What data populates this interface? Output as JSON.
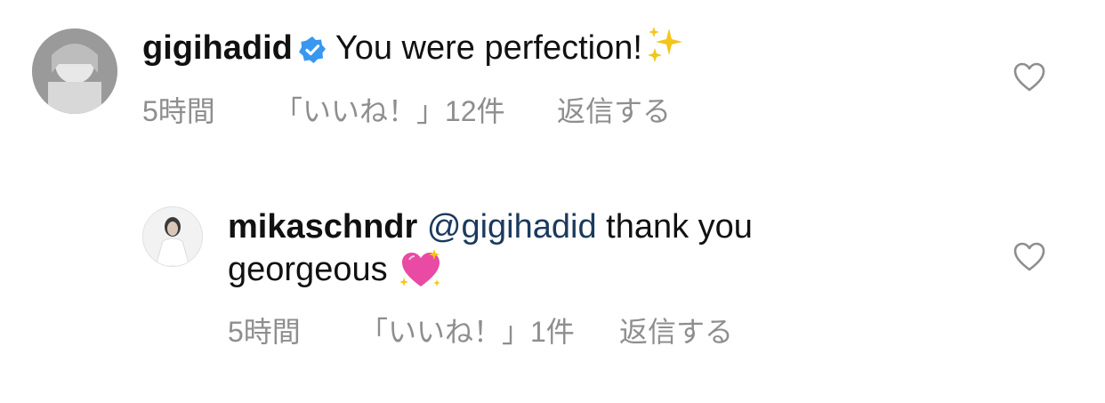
{
  "comments": [
    {
      "username": "gigihadid",
      "verified": true,
      "text": "You were perfection!",
      "emoji": "sparkles",
      "time": "5時間",
      "likes": "「いいね！」12件",
      "reply": "返信する"
    },
    {
      "username": "mikaschndr",
      "mention": "@gigihadid",
      "text_line1": "thank you",
      "text_line2": "georgeous",
      "emoji": "sparkling-heart",
      "time": "5時間",
      "likes": "「いいね！」1件",
      "reply": "返信する"
    }
  ],
  "colors": {
    "verified_badge": "#3897f0",
    "meta_text": "#8e8e8e",
    "mention": "#1b3a5e",
    "heart_outline": "#8e8e8e"
  }
}
